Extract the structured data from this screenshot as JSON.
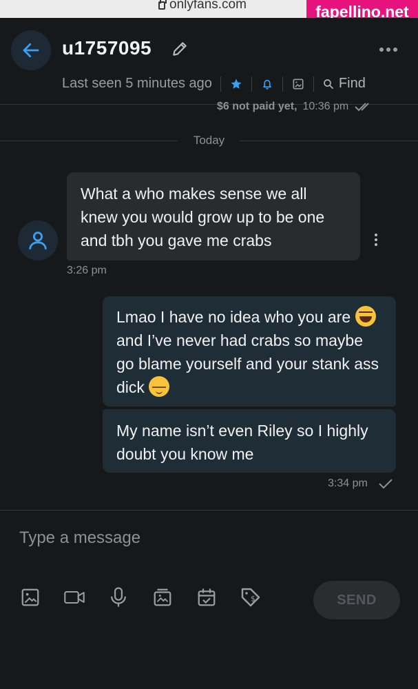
{
  "browser": {
    "url": "onlyfans.com",
    "watermark": "fapellino.net"
  },
  "header": {
    "username": "u1757095",
    "last_seen": "Last seen 5 minutes ago",
    "find_label": "Find",
    "icons": [
      "back-arrow-icon",
      "pencil-icon",
      "more-icon",
      "star-icon",
      "bell-icon",
      "image-icon",
      "search-icon"
    ],
    "accent": "#3aa0f0"
  },
  "chat": {
    "previous_message_status": "$6 not paid yet,",
    "previous_message_time": "10:36 pm",
    "date_divider": "Today",
    "messages": [
      {
        "direction": "incoming",
        "text": "What a who makes sense we all knew you would grow up to be one and tbh you gave me crabs",
        "time": "3:26 pm"
      },
      {
        "direction": "outgoing",
        "parts": [
          "Lmao I have no idea who you are",
          "and I’ve never had crabs so maybe go blame yourself and your stank ass dick"
        ],
        "emojis": [
          "face-with-tears-of-joy",
          "relieved-face"
        ]
      },
      {
        "direction": "outgoing",
        "text": "My name isn’t even Riley so I highly doubt you know me",
        "time": "3:34 pm"
      }
    ]
  },
  "composer": {
    "placeholder": "Type a message",
    "send_label": "SEND",
    "tools": [
      "image-icon",
      "video-icon",
      "microphone-icon",
      "media-vault-icon",
      "calendar-check-icon",
      "price-tag-icon"
    ]
  }
}
